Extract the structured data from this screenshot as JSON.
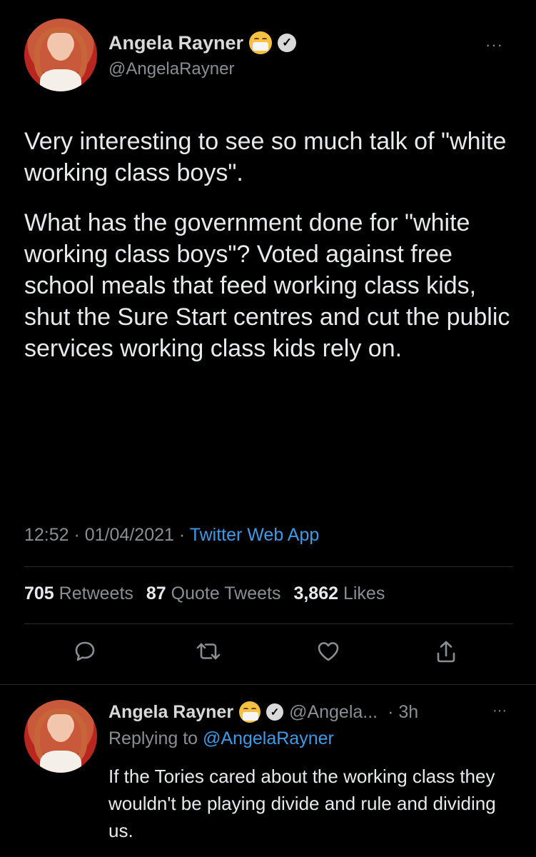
{
  "main_tweet": {
    "author_name": "Angela Rayner",
    "author_handle": "@AngelaRayner",
    "paragraphs": [
      "Very interesting to see so much talk of \"white working class boys\".",
      "What has the government done for \"white working class boys\"? Voted against free school meals that feed working class kids, shut the Sure Start centres and cut the public services working class kids rely on."
    ],
    "time": "12:52",
    "date": "01/04/2021",
    "separator": "·",
    "source": "Twitter Web App",
    "stats": {
      "retweets_count": "705",
      "retweets_label": "Retweets",
      "quotes_count": "87",
      "quotes_label": "Quote Tweets",
      "likes_count": "3,862",
      "likes_label": "Likes"
    },
    "more": "···",
    "verified_mark": "✓"
  },
  "reply_tweet": {
    "author_name": "Angela Rayner",
    "author_handle": "@Angela...",
    "time": "· 3h",
    "replying_prefix": "Replying to",
    "replying_to": "@AngelaRayner",
    "text": "If the Tories cared about the working class they wouldn't be playing divide and rule and dividing us.",
    "more": "···",
    "verified_mark": "✓"
  },
  "icons": {
    "reply": "speech-bubble-icon",
    "retweet": "retweet-icon",
    "like": "heart-icon",
    "share": "share-icon"
  },
  "colors": {
    "background": "#000000",
    "text": "#e7e9ea",
    "muted": "#8a8d91",
    "link": "#3b9be8",
    "divider": "#2a2d30"
  }
}
